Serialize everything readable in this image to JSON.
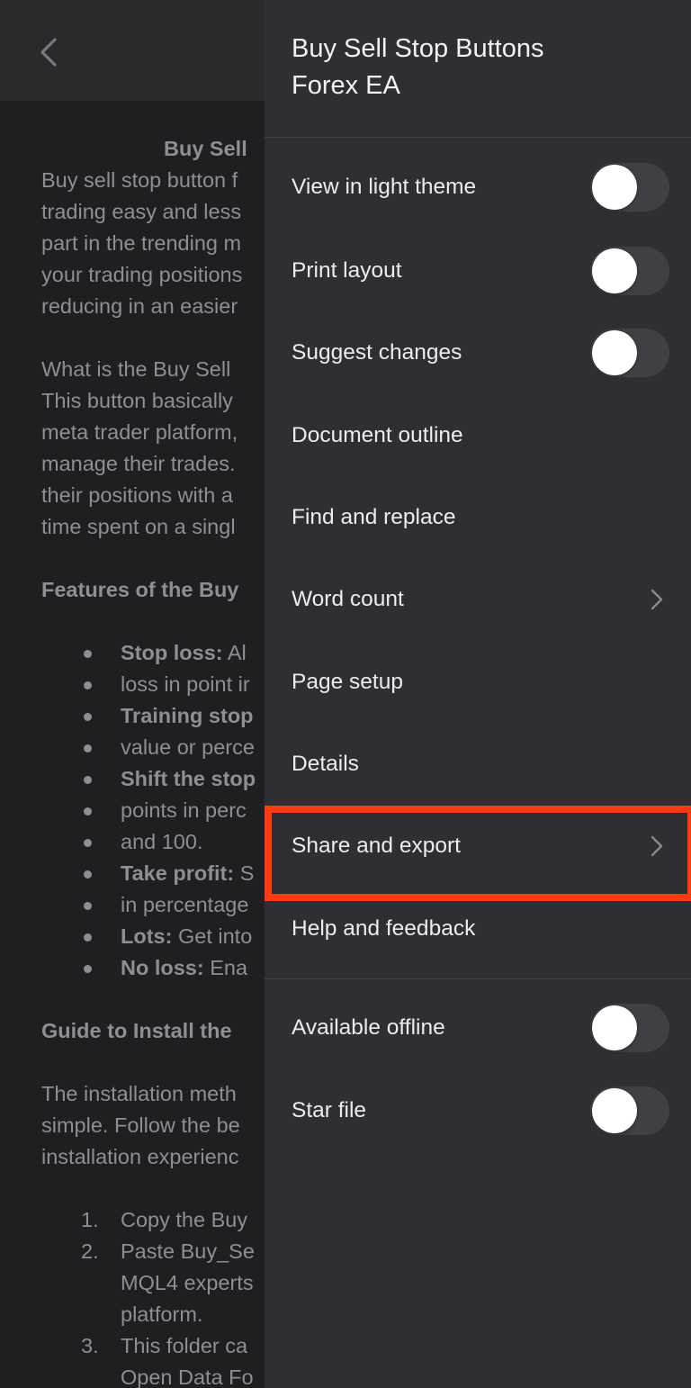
{
  "app": {
    "accent_highlight": "#ff3b12"
  },
  "header": {
    "back_icon": "chevron-left-icon"
  },
  "document": {
    "title": "Buy Sell",
    "paragraph1": [
      "Buy sell stop button f",
      "trading easy and less",
      "part in the trending m",
      "your trading positions",
      "reducing in an easier"
    ],
    "paragraph2": [
      "What is the Buy Sell",
      "This button basically",
      "meta trader platform,",
      "manage their trades.",
      "their positions with a",
      "time spent on a singl"
    ],
    "features_heading": "Features of the Buy",
    "features": [
      {
        "term": "Stop loss:",
        "rest": " Al",
        "continuation": "loss in point ir"
      },
      {
        "term": "Training stop",
        "rest": "",
        "continuation": "value or perce"
      },
      {
        "term": "Shift the stop",
        "rest": "",
        "continuation": "points in perc",
        "continuation2": "and 100."
      },
      {
        "term": "Take profit:",
        "rest": " S",
        "continuation": "in percentage"
      },
      {
        "term": "Lots:",
        "rest": " Get into",
        "continuation": ""
      },
      {
        "term": "No loss:",
        "rest": " Ena",
        "continuation": ""
      }
    ],
    "install_heading": "Guide to Install the",
    "paragraph3": [
      "The installation meth",
      "simple. Follow the be",
      "installation experienc"
    ],
    "steps": [
      {
        "num": "1.",
        "lines": [
          "Copy the Buy"
        ]
      },
      {
        "num": "2.",
        "lines": [
          "Paste Buy_Se",
          "MQL4 experts",
          "platform."
        ]
      },
      {
        "num": "3.",
        "lines": [
          "This folder ca",
          "Open Data Fo"
        ]
      }
    ]
  },
  "drawer": {
    "title_line1": "Buy Sell Stop Buttons",
    "title_line2": "Forex EA",
    "items": [
      {
        "label": "View in light theme",
        "control": "toggle",
        "on": false
      },
      {
        "label": "Print layout",
        "control": "toggle",
        "on": false
      },
      {
        "label": "Suggest changes",
        "control": "toggle",
        "on": false
      },
      {
        "label": "Document outline",
        "control": "none"
      },
      {
        "label": "Find and replace",
        "control": "none"
      },
      {
        "label": "Word count",
        "control": "chevron"
      },
      {
        "label": "Page setup",
        "control": "none"
      },
      {
        "label": "Details",
        "control": "none"
      },
      {
        "label": "Share and export",
        "control": "chevron",
        "highlighted": true
      },
      {
        "label": "Help and feedback",
        "control": "none"
      }
    ],
    "secondary_items": [
      {
        "label": "Available offline",
        "control": "toggle",
        "on": false
      },
      {
        "label": "Star file",
        "control": "toggle",
        "on": false
      }
    ]
  }
}
